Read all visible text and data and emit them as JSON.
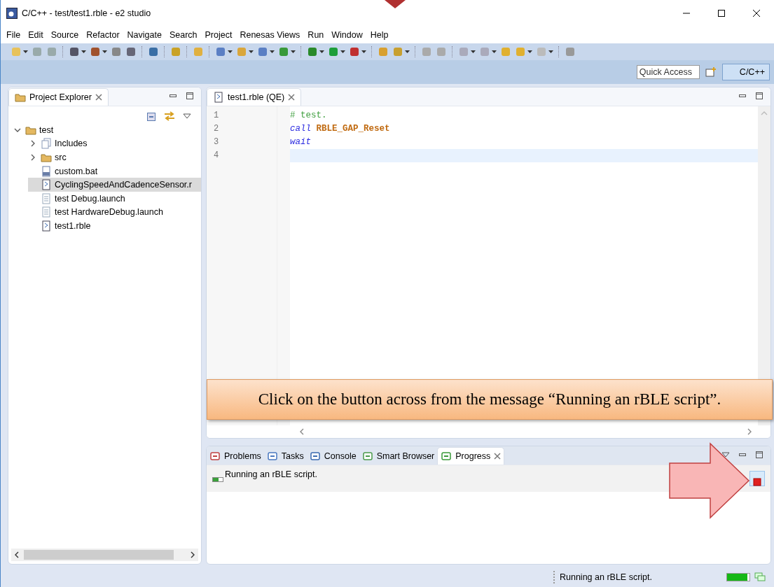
{
  "window": {
    "title": "C/C++ - test/test1.rble - e2 studio"
  },
  "menu": [
    "File",
    "Edit",
    "Source",
    "Refactor",
    "Navigate",
    "Search",
    "Project",
    "Renesas Views",
    "Run",
    "Window",
    "Help"
  ],
  "quick_access": {
    "placeholder": "Quick Access"
  },
  "perspective": {
    "label": "C/C++",
    "selected": true
  },
  "project_explorer": {
    "title": "Project Explorer",
    "tree": [
      {
        "label": "test",
        "kind": "project",
        "expanded": true,
        "selected": false,
        "children": [
          {
            "label": "Includes",
            "kind": "includes",
            "expanded": false,
            "selected": false
          },
          {
            "label": "src",
            "kind": "folder",
            "expanded": false,
            "selected": false
          },
          {
            "label": "custom.bat",
            "kind": "binary",
            "selected": false
          },
          {
            "label": "CyclingSpeedAndCadenceSensor.r",
            "kind": "script",
            "selected": true
          },
          {
            "label": "test Debug.launch",
            "kind": "file",
            "selected": false
          },
          {
            "label": "test HardwareDebug.launch",
            "kind": "file",
            "selected": false
          },
          {
            "label": "test1.rble",
            "kind": "script",
            "selected": false
          }
        ]
      }
    ]
  },
  "editor": {
    "tab": "test1.rble (QE)",
    "lines": [
      {
        "number": "1",
        "current": false,
        "tokens": [
          {
            "text": "# test.",
            "kind": "comment"
          }
        ]
      },
      {
        "number": "2",
        "current": false,
        "tokens": [
          {
            "text": "call",
            "kind": "keyword"
          },
          {
            "text": "RBLE_GAP_Reset",
            "kind": "function"
          }
        ]
      },
      {
        "number": "3",
        "current": false,
        "tokens": [
          {
            "text": "wait",
            "kind": "keyword"
          }
        ]
      },
      {
        "number": "4",
        "current": true
      }
    ]
  },
  "bottom_panel": {
    "tabs": [
      {
        "label": "Problems",
        "kind": "problems",
        "selected": false
      },
      {
        "label": "Tasks",
        "kind": "tasks",
        "selected": false
      },
      {
        "label": "Console",
        "kind": "console",
        "selected": false
      },
      {
        "label": "Smart Browser",
        "kind": "browser",
        "selected": false
      },
      {
        "label": "Progress",
        "kind": "progress",
        "selected": true
      }
    ],
    "progress_items": [
      {
        "text": "Running an rBLE script."
      }
    ]
  },
  "callout": {
    "text": "Click on the button across from the message “Running an rBLE script”."
  },
  "status_bar": {
    "text": "Running an rBLE script.",
    "level": 0.9
  }
}
